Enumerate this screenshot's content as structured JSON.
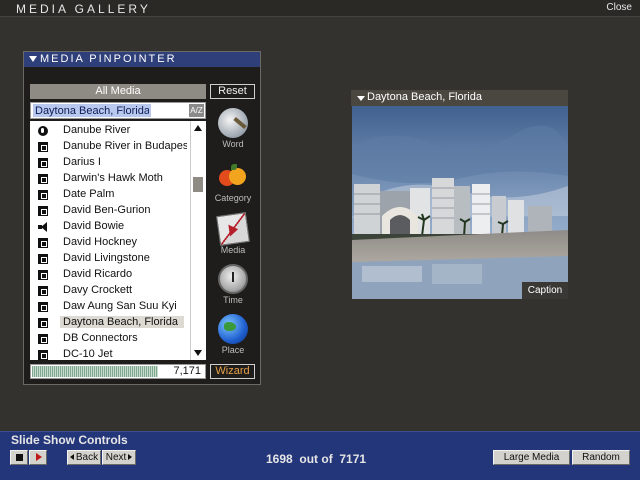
{
  "window": {
    "title": "MEDIA GALLERY",
    "close_label": "Close"
  },
  "pinpointer": {
    "title": "MEDIA PINPOINTER",
    "filter_label": "All Media",
    "reset_label": "Reset",
    "search_value": "Daytona Beach, Florida",
    "search_button": "A/Z",
    "items": [
      {
        "label": "Danube River",
        "icon": "globe-icon"
      },
      {
        "label": "Danube River in Budapest",
        "icon": "picture-icon"
      },
      {
        "label": "Darius I",
        "icon": "picture-icon"
      },
      {
        "label": "Darwin's Hawk Moth",
        "icon": "picture-icon"
      },
      {
        "label": "Date Palm",
        "icon": "picture-icon"
      },
      {
        "label": "David Ben-Gurion",
        "icon": "picture-icon"
      },
      {
        "label": "David Bowie",
        "icon": "speaker-icon"
      },
      {
        "label": "David Hockney",
        "icon": "picture-icon"
      },
      {
        "label": "David Livingstone",
        "icon": "picture-icon"
      },
      {
        "label": "David Ricardo",
        "icon": "picture-icon"
      },
      {
        "label": "Davy Crockett",
        "icon": "picture-icon"
      },
      {
        "label": "Daw Aung San Suu Kyi",
        "icon": "picture-icon"
      },
      {
        "label": "Daytona Beach, Florida",
        "icon": "picture-icon",
        "selected": true
      },
      {
        "label": "DB Connectors",
        "icon": "picture-icon"
      },
      {
        "label": "DC-10 Jet",
        "icon": "picture-icon"
      }
    ],
    "count": "7,171",
    "wizard_label": "Wizard",
    "tools": [
      {
        "label": "Word",
        "icon": "magnifier-icon"
      },
      {
        "label": "Category",
        "icon": "fruit-icon"
      },
      {
        "label": "Media",
        "icon": "media-icon"
      },
      {
        "label": "Time",
        "icon": "sundial-icon"
      },
      {
        "label": "Place",
        "icon": "globe-icon"
      }
    ]
  },
  "preview": {
    "title": "Daytona Beach, Florida",
    "caption_label": "Caption"
  },
  "slideshow": {
    "title": "Slide Show Controls",
    "back_label": "Back",
    "next_label": "Next",
    "current": "1698",
    "out_of": "out of",
    "total": "7171",
    "large_media_label": "Large Media",
    "random_label": "Random"
  },
  "colors": {
    "header_blue": "#2f3f7a",
    "bottom_bar": "#24367a",
    "wizard_orange": "#e8a04a",
    "background": "#34322f"
  }
}
